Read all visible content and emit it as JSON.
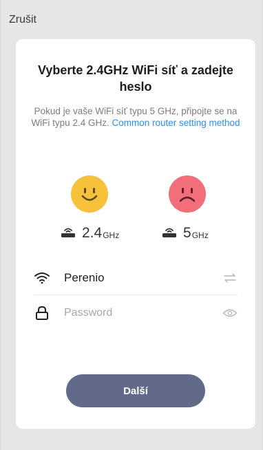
{
  "header": {
    "cancel_label": "Zrušit"
  },
  "card": {
    "title": "Vyberte 2.4GHz WiFi síť a zadejte heslo",
    "description": "Pokud je vaše WiFi síť typu 5 GHz, připojte se na WiFi typu 2.4 GHz. ",
    "link_text": "Common router setting method"
  },
  "bands": {
    "supported": {
      "value": "2.4",
      "unit": "GHz",
      "icon": "router-icon",
      "face": "happy-face-icon",
      "color": "#f6c23c"
    },
    "unsupported": {
      "value": "5",
      "unit": "GHz",
      "icon": "router-icon",
      "face": "sad-face-icon",
      "color": "#f26e7b"
    }
  },
  "form": {
    "ssid": {
      "value": "Perenio",
      "icon": "wifi-icon",
      "action_icon": "switch-network-icon"
    },
    "password": {
      "value": "",
      "placeholder": "Password",
      "icon": "lock-icon",
      "action_icon": "eye-icon"
    }
  },
  "actions": {
    "next_label": "Další",
    "next_color": "#626a8a"
  }
}
